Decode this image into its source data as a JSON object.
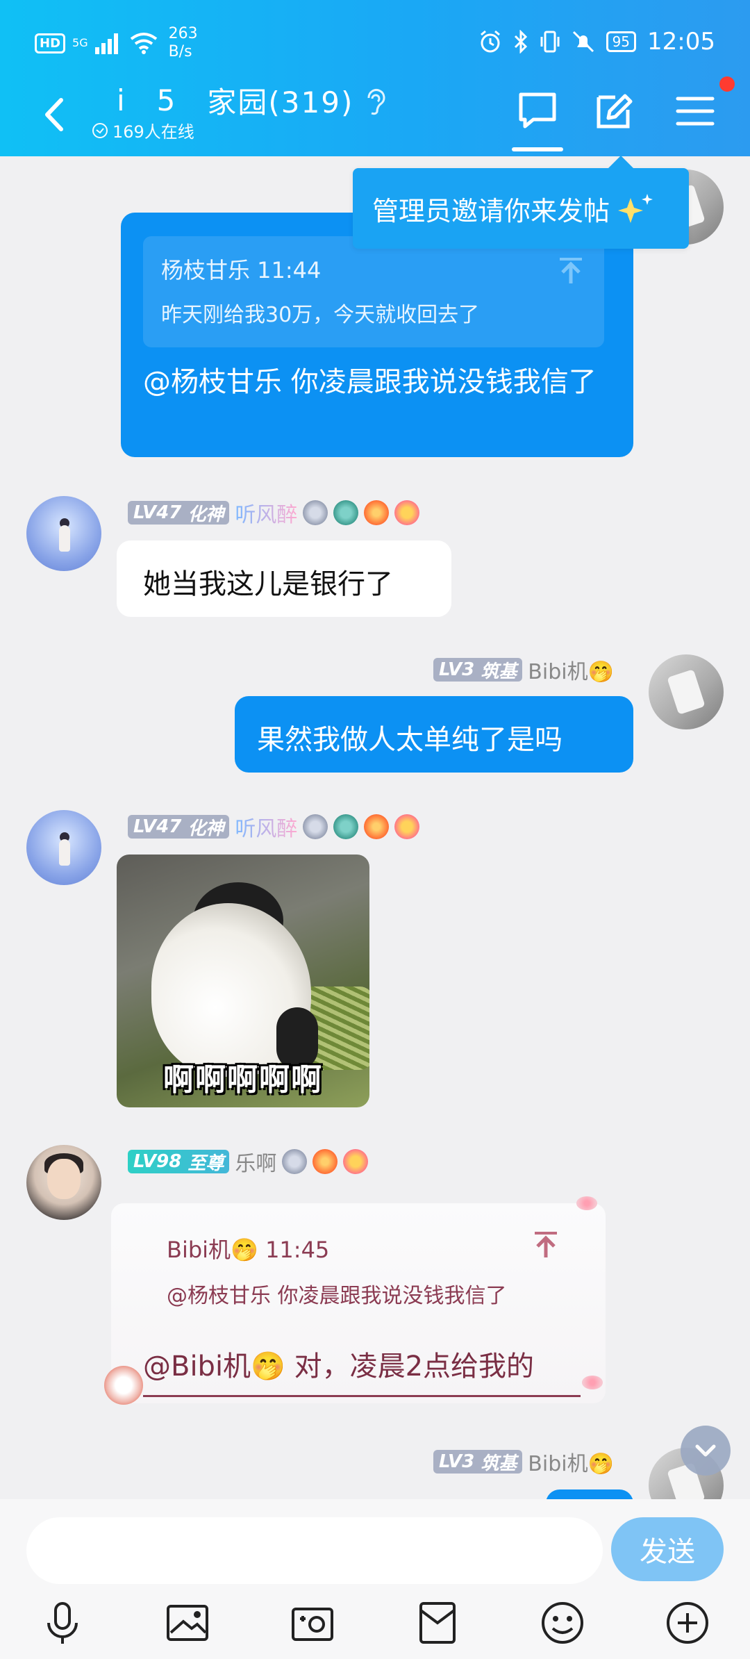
{
  "status": {
    "net_speed": "263\nB/s",
    "net_speed_top": "263",
    "net_speed_bot": "B/s",
    "sig_top": "5G",
    "hd": "HD",
    "battery": "95",
    "time": "12:05"
  },
  "header": {
    "title_i": "i",
    "title_5": "5",
    "title_main": "家园(319)",
    "online": "169人在线"
  },
  "tooltip": "管理员邀请你来发帖",
  "messages": {
    "m1": {
      "quote_header": "杨枝甘乐 11:44",
      "quote_text": "昨天刚给我30万，今天就收回去了",
      "text": "@杨枝甘乐 你凌晨跟我说没钱我信了"
    },
    "m2": {
      "level": "LV47",
      "rank": "化神",
      "user": "听风醉",
      "text": "她当我这儿是银行了"
    },
    "m3": {
      "level": "LV3",
      "rank": "筑基",
      "user": "Bibi机🤭",
      "text": "果然我做人太单纯了是吗"
    },
    "m4": {
      "level": "LV47",
      "rank": "化神",
      "user": "听风醉",
      "sticker_caption": "啊啊啊啊啊"
    },
    "m5": {
      "level": "LV98",
      "rank": "至尊",
      "user": "乐啊",
      "quote_header": "Bibi机🤭 11:45",
      "quote_text": "@杨枝甘乐 你凌晨跟我说没钱我信了",
      "text": "@Bibi机🤭 对，凌晨2点给我的"
    },
    "m6": {
      "level": "LV3",
      "rank": "筑基",
      "user": "Bibi机🤭"
    }
  },
  "composer": {
    "placeholder": "",
    "send_label": "发送"
  },
  "icons": {
    "back": "back-arrow-icon",
    "chat": "chat-icon",
    "edit": "edit-icon",
    "menu": "menu-icon",
    "mic": "microphone-icon",
    "image": "image-icon",
    "camera": "camera-icon",
    "pocket": "pocket-icon",
    "emoji": "emoji-icon",
    "plus": "plus-icon"
  },
  "colors": {
    "accent": "#0c91f3",
    "header_start": "#10c0f5",
    "header_end": "#2c9bf0",
    "send_disabled": "#7fc4f5"
  }
}
